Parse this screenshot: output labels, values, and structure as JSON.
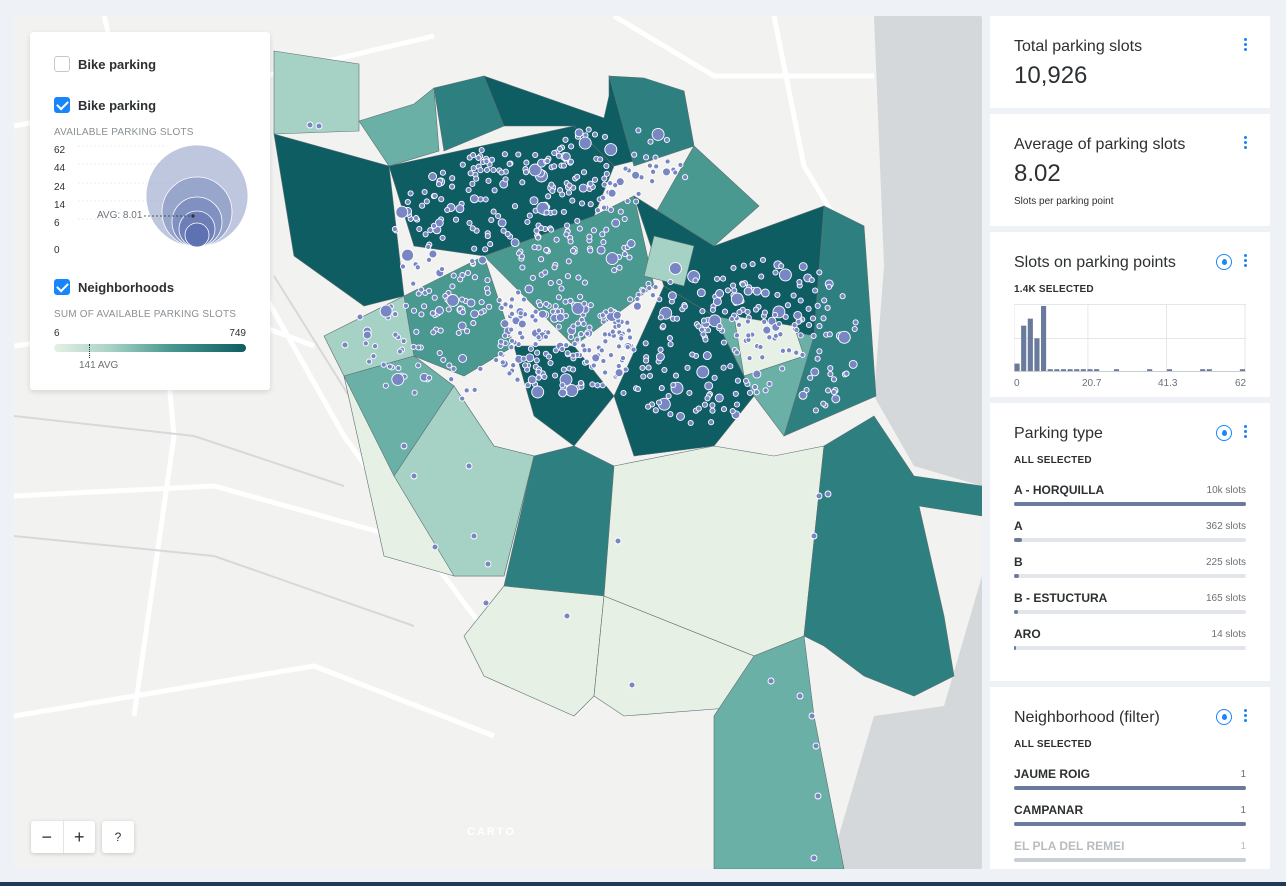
{
  "legend": {
    "layers": [
      {
        "label": "Bike parking",
        "checked": false
      },
      {
        "label": "Bike parking",
        "checked": true
      },
      {
        "label": "Neighborhoods",
        "checked": true
      }
    ],
    "bubble": {
      "title": "AVAILABLE PARKING SLOTS",
      "ticks": [
        "62",
        "44",
        "24",
        "14",
        "6",
        "0"
      ],
      "avg_label": "AVG: 8.01"
    },
    "choropleth": {
      "title": "SUM OF AVAILABLE PARKING SLOTS",
      "min": "6",
      "max": "749",
      "avg_label": "141 AVG",
      "avg_value": 141,
      "range": [
        6,
        749
      ]
    }
  },
  "map": {
    "zoom_out": "−",
    "zoom_in": "+",
    "help": "?",
    "attribution": "CARTO",
    "colors": {
      "low": "#e6f0e4",
      "mid": "#6ab0a6",
      "high": "#0e5d62",
      "point": "#7887c4",
      "point_stroke": "#ffffff"
    }
  },
  "widgets": {
    "total": {
      "title": "Total parking slots",
      "value": "10,926"
    },
    "average": {
      "title": "Average of parking slots",
      "value": "8.02",
      "note": "Slots per parking point"
    },
    "histogram": {
      "title": "Slots on parking points",
      "status": "1.4K SELECTED",
      "axis": [
        "0",
        "20.7",
        "41.3",
        "62"
      ],
      "bins": [
        6,
        33,
        38,
        24,
        47,
        2,
        2,
        2,
        2,
        2,
        2,
        2,
        2,
        0,
        0,
        2,
        0,
        0,
        0,
        0,
        2,
        0,
        0,
        2,
        0,
        0,
        0,
        0,
        2,
        2,
        0,
        0,
        0,
        0,
        2
      ]
    },
    "parking_type": {
      "title": "Parking type",
      "status": "ALL SELECTED",
      "items": [
        {
          "label": "A - HORQUILLA",
          "count": "10k slots",
          "share": 1.0
        },
        {
          "label": "A",
          "count": "362 slots",
          "share": 0.035
        },
        {
          "label": "B",
          "count": "225 slots",
          "share": 0.022
        },
        {
          "label": "B - ESTUCTURA",
          "count": "165 slots",
          "share": 0.016
        },
        {
          "label": "ARO",
          "count": "14 slots",
          "share": 0.004
        }
      ]
    },
    "neighborhood": {
      "title": "Neighborhood (filter)",
      "status": "ALL SELECTED",
      "items": [
        {
          "label": "JAUME ROIG",
          "count": "1",
          "share": 1.0
        },
        {
          "label": "CAMPANAR",
          "count": "1",
          "share": 1.0
        },
        {
          "label": "EL PLA DEL REMEI",
          "count": "1",
          "share": 1.0
        }
      ]
    }
  }
}
